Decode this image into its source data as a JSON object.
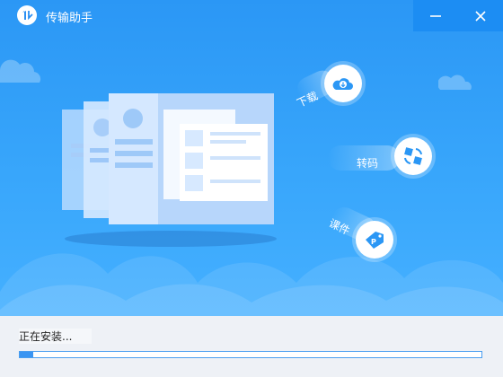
{
  "window": {
    "title": "传输助手"
  },
  "controls": {
    "minimize_icon": "minimize-icon",
    "close_icon": "close-icon"
  },
  "features": [
    {
      "label": "下载",
      "icon": "download-cloud-icon"
    },
    {
      "label": "转码",
      "icon": "transcode-icon"
    },
    {
      "label": "课件",
      "icon": "courseware-icon"
    }
  ],
  "install": {
    "status": "正在安装...",
    "progress_fraction": 0.03
  },
  "colors": {
    "accent": "#2b97f5",
    "progress": "#3a95f2"
  }
}
